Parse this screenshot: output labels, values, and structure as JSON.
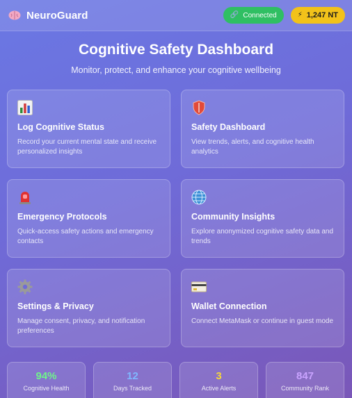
{
  "header": {
    "brand_name": "NeuroGuard",
    "brand_icon": "brain-icon",
    "connected_label": "Connected",
    "connected_icon": "link-icon",
    "token_balance": "1,247 NT",
    "token_icon": "lightning-icon"
  },
  "main": {
    "title": "Cognitive Safety Dashboard",
    "subtitle": "Monitor, protect, and enhance your cognitive wellbeing"
  },
  "cards": [
    {
      "icon": "bar-chart-icon",
      "title": "Log Cognitive Status",
      "description": "Record your current mental state and receive personalized insights"
    },
    {
      "icon": "shield-icon",
      "title": "Safety Dashboard",
      "description": "View trends, alerts, and cognitive health analytics"
    },
    {
      "icon": "siren-icon",
      "title": "Emergency Protocols",
      "description": "Quick-access safety actions and emergency contacts"
    },
    {
      "icon": "globe-icon",
      "title": "Community Insights",
      "description": "Explore anonymized cognitive safety data and trends"
    },
    {
      "icon": "gear-icon",
      "title": "Settings & Privacy",
      "description": "Manage consent, privacy, and notification preferences"
    },
    {
      "icon": "credit-card-icon",
      "title": "Wallet Connection",
      "description": "Connect MetaMask or continue in guest mode"
    }
  ],
  "stats": [
    {
      "value": "94%",
      "label": "Cognitive Health",
      "color": "#6ff58a"
    },
    {
      "value": "12",
      "label": "Days Tracked",
      "color": "#7fb8ff"
    },
    {
      "value": "3",
      "label": "Active Alerts",
      "color": "#f5d63a"
    },
    {
      "value": "847",
      "label": "Community Rank",
      "color": "#c9a3ff"
    }
  ],
  "colors": {
    "connected": "#2fbf63",
    "tokens": "#f2c21a"
  }
}
